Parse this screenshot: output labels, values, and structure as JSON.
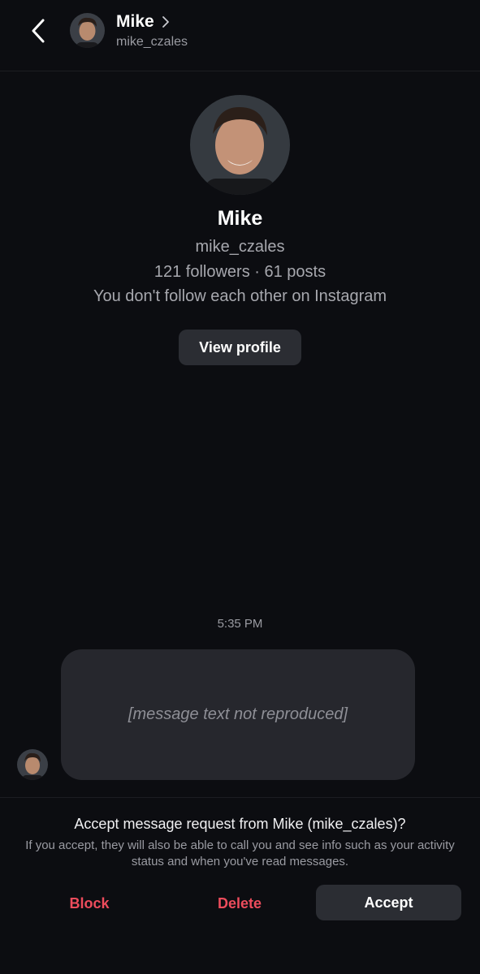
{
  "header": {
    "name": "Mike",
    "username": "mike_czales",
    "icons": {
      "back": "chevron-left-icon",
      "profile_link": "chevron-right-icon"
    }
  },
  "profile": {
    "name": "Mike",
    "username": "mike_czales",
    "stats": "121 followers · 61 posts",
    "relation": "You don't follow each other on Instagram",
    "view_profile_label": "View profile"
  },
  "conversation": {
    "timestamp": "5:35 PM",
    "message": {
      "sender": "Mike",
      "text": "[message text not reproduced]"
    }
  },
  "request": {
    "title": "Accept message request from Mike (mike_czales)?",
    "info": "If you accept, they will also be able to call you and see info such as your activity status and when you've read messages.",
    "block_label": "Block",
    "delete_label": "Delete",
    "accept_label": "Accept"
  },
  "colors": {
    "background": "#0c0d11",
    "bubble": "#26272d",
    "button": "#2b2d33",
    "destructive": "#ed4c5c",
    "secondary_text": "#9a9ba2"
  }
}
